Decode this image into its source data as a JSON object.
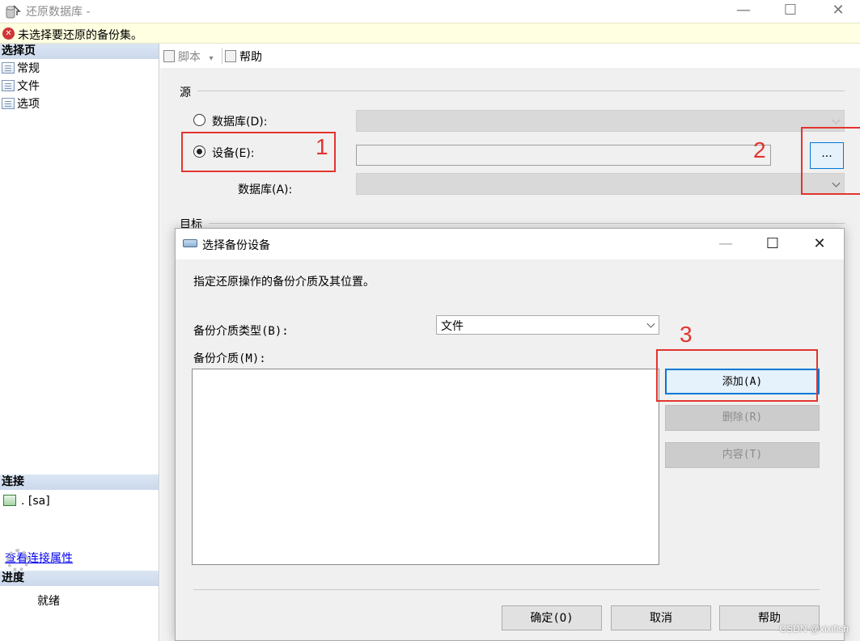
{
  "window": {
    "title": "还原数据库 -",
    "minimize": "—",
    "maximize": "☐",
    "close": "✕",
    "error_message": "未选择要还原的备份集。"
  },
  "sidebar": {
    "select_page_header": "选择页",
    "pages": [
      {
        "label": "常规"
      },
      {
        "label": "文件"
      },
      {
        "label": "选项"
      }
    ],
    "connection_header": "连接",
    "connection": ". [sa]",
    "view_connection_link": "查看连接属性",
    "progress_header": "进度",
    "progress_status": "就绪"
  },
  "toolbar": {
    "script_label": "脚本",
    "script_arrow": "▾",
    "help_label": "帮助"
  },
  "source": {
    "section_label": "源",
    "database_radio": "数据库(D):",
    "device_radio": "设备(E):",
    "database_label": "数据库(A):",
    "browse_button": "...",
    "selected": "device"
  },
  "target": {
    "section_label": "目标"
  },
  "annotations": {
    "n1": "1",
    "n2": "2",
    "n3": "3"
  },
  "dialog": {
    "title": "选择备份设备",
    "minimize": "—",
    "maximize": "☐",
    "close": "✕",
    "description": "指定还原操作的备份介质及其位置。",
    "media_type_label": "备份介质类型(B):",
    "media_type_value": "文件",
    "media_label": "备份介质(M):",
    "media_items": [],
    "add_button": "添加(A)",
    "remove_button": "删除(R)",
    "contents_button": "内容(T)",
    "ok_button": "确定(O)",
    "cancel_button": "取消",
    "help_button": "帮助"
  },
  "watermark": "CSDN @xixifish"
}
